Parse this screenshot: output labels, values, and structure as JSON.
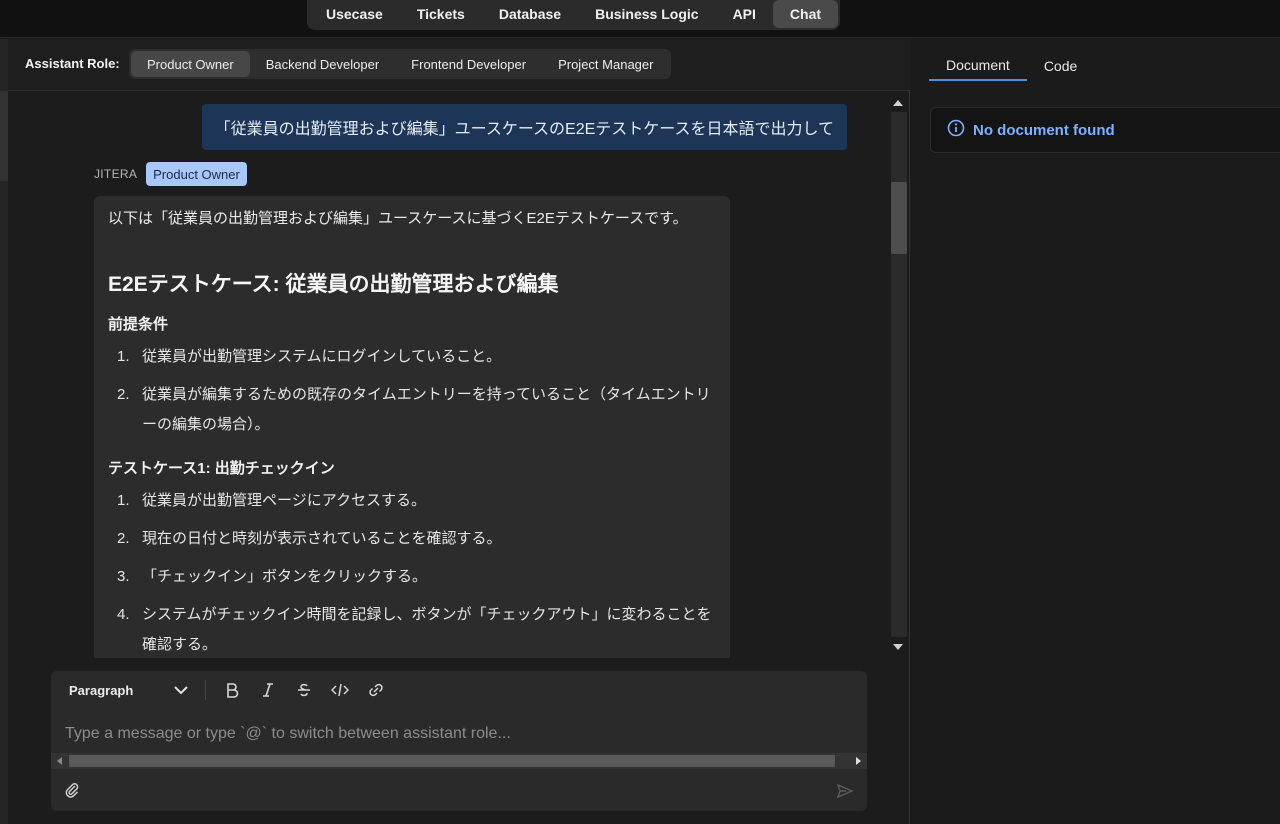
{
  "topnav": {
    "tabs": [
      {
        "label": "Usecase"
      },
      {
        "label": "Tickets"
      },
      {
        "label": "Database"
      },
      {
        "label": "Business Logic"
      },
      {
        "label": "API"
      },
      {
        "label": "Chat"
      }
    ],
    "active": "Chat"
  },
  "role_bar": {
    "label": "Assistant Role:",
    "roles": [
      {
        "label": "Product Owner"
      },
      {
        "label": "Backend Developer"
      },
      {
        "label": "Frontend Developer"
      },
      {
        "label": "Project Manager"
      }
    ],
    "active": "Product Owner"
  },
  "chat": {
    "user_message": "「従業員の出勤管理および編集」ユースケースのE2Eテストケースを日本語で出力して",
    "sender_name": "JITERA",
    "sender_role": "Product Owner",
    "answer": {
      "intro": "以下は「従業員の出勤管理および編集」ユースケースに基づくE2Eテストケースです。",
      "heading": "E2Eテストケース: 従業員の出勤管理および編集",
      "preconditions_title": "前提条件",
      "preconditions": [
        {
          "num": "1.",
          "text": "従業員が出勤管理システムにログインしていること。"
        },
        {
          "num": "2.",
          "text": "従業員が編集するための既存のタイムエントリーを持っていること（タイムエントリーの編集の場合）。"
        }
      ],
      "testcase1_title": "テストケース1: 出勤チェックイン",
      "testcase1_steps": [
        {
          "num": "1.",
          "text": "従業員が出勤管理ページにアクセスする。"
        },
        {
          "num": "2.",
          "text": "現在の日付と時刻が表示されていることを確認する。"
        },
        {
          "num": "3.",
          "text": "「チェックイン」ボタンをクリックする。"
        },
        {
          "num": "4.",
          "text": "システムがチェックイン時間を記録し、ボタンが「チェックアウト」に変わることを確認する。"
        }
      ]
    }
  },
  "composer": {
    "format_label": "Paragraph",
    "placeholder": "Type a message or type `@` to switch between assistant role..."
  },
  "doc_panel": {
    "tabs": [
      {
        "label": "Document"
      },
      {
        "label": "Code"
      }
    ],
    "active": "Document",
    "empty_message": "No document found",
    "accent_color": "#7cb2ff"
  },
  "icons": [
    "chevron-down-icon",
    "bold-icon",
    "italic-icon",
    "strikethrough-icon",
    "code-icon",
    "link-icon",
    "paperclip-icon",
    "send-icon",
    "info-icon"
  ]
}
